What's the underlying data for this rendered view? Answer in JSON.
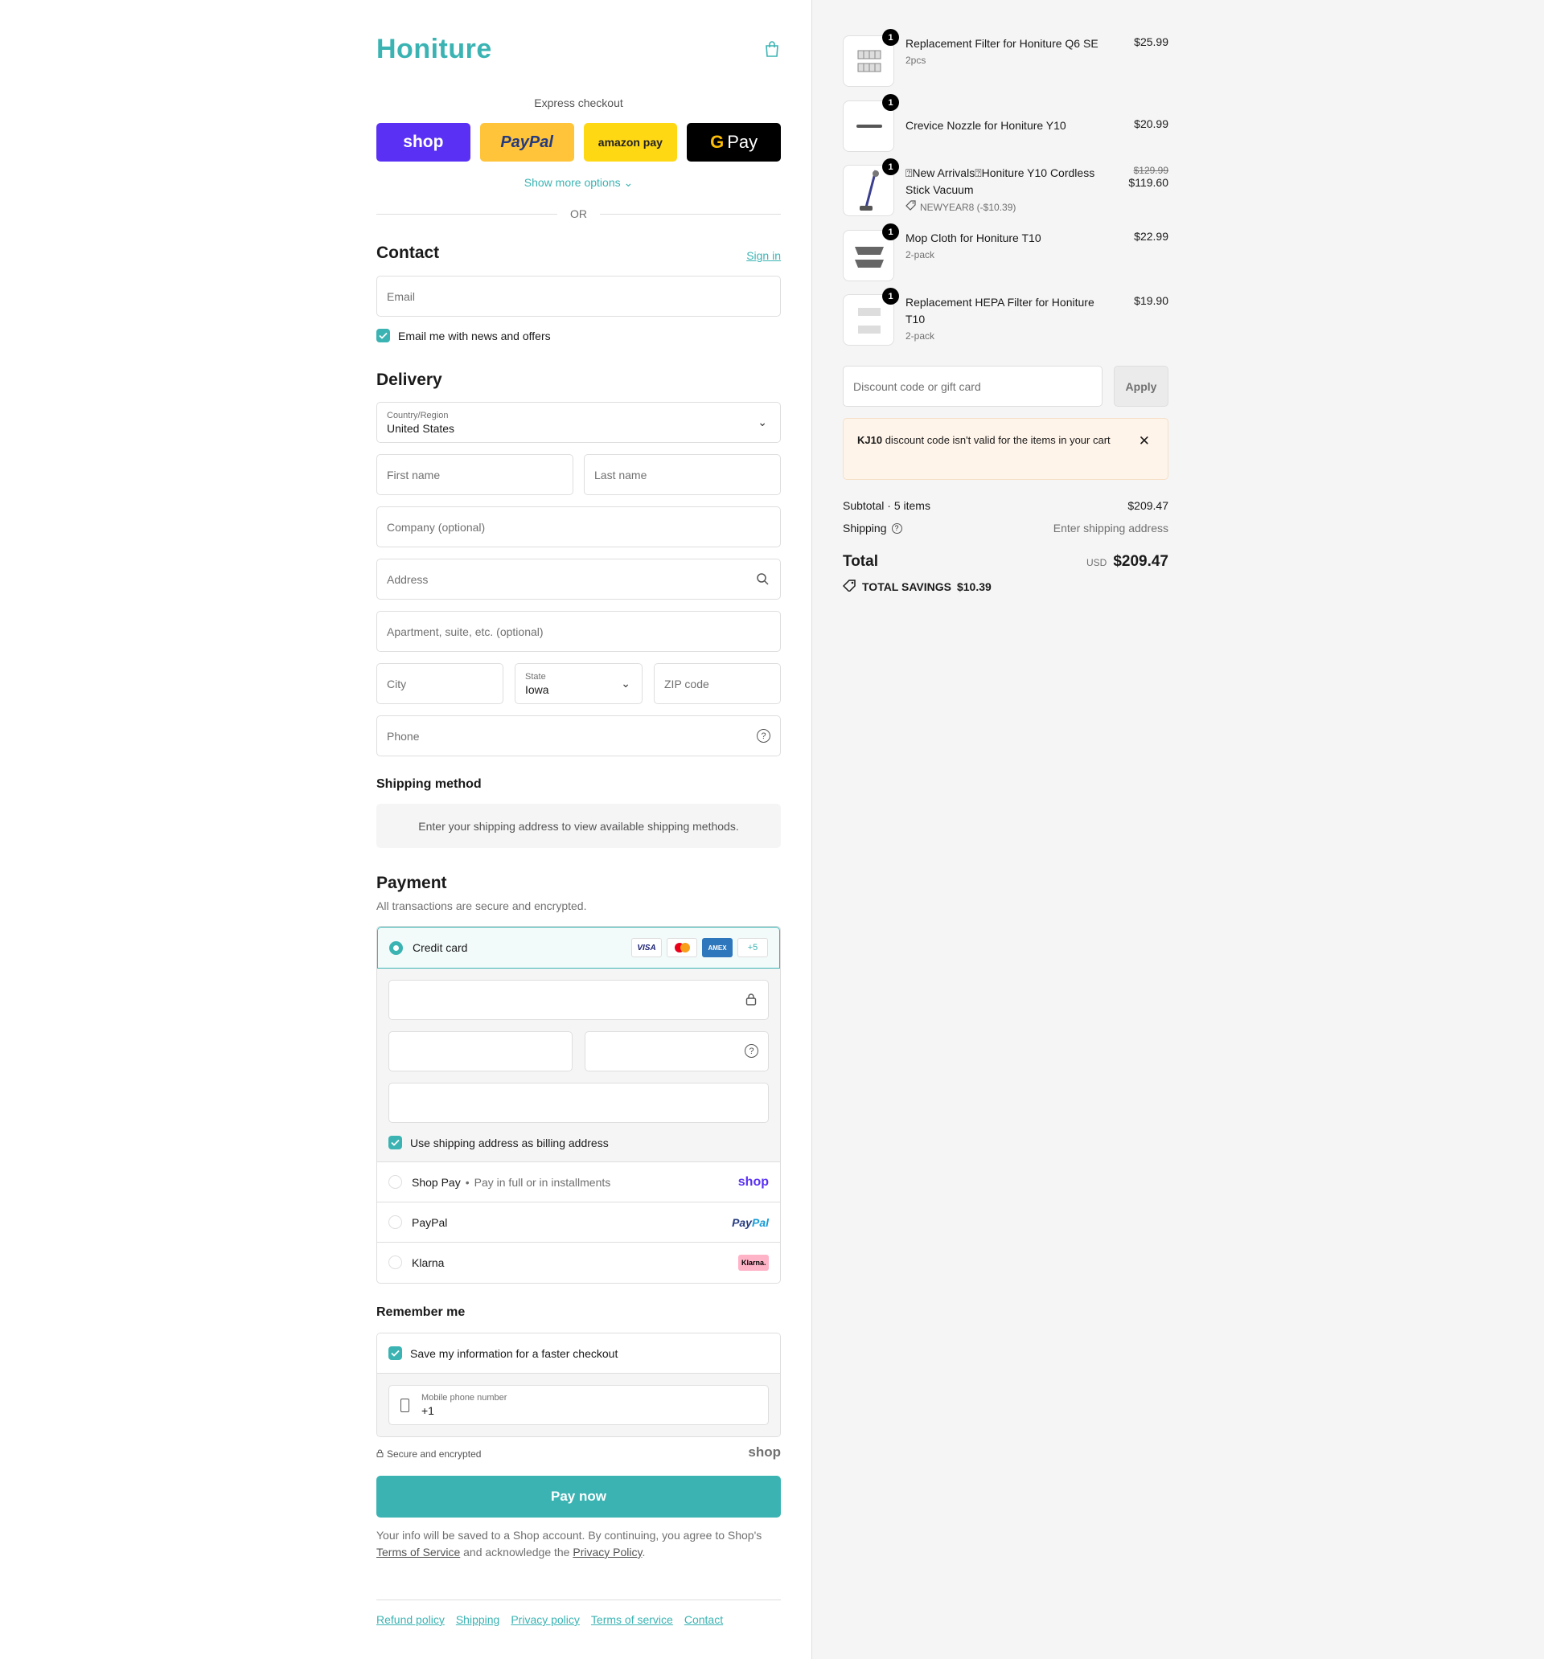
{
  "brand": {
    "logo": "Honiture",
    "accent": "#3bb3b3"
  },
  "express": {
    "label": "Express checkout",
    "shop": "shop",
    "paypal": "PayPal",
    "amazon": "amazon pay",
    "gpay": "Pay",
    "more": "Show more options",
    "or": "OR"
  },
  "contact": {
    "title": "Contact",
    "signin": "Sign in",
    "email_placeholder": "Email",
    "newsletter": "Email me with news and offers"
  },
  "delivery": {
    "title": "Delivery",
    "country_label": "Country/Region",
    "country_value": "United States",
    "first_name": "First name",
    "last_name": "Last name",
    "company": "Company (optional)",
    "address": "Address",
    "apartment": "Apartment, suite, etc. (optional)",
    "city": "City",
    "state_label": "State",
    "state_value": "Iowa",
    "zip": "ZIP code",
    "phone": "Phone"
  },
  "shipping_method": {
    "title": "Shipping method",
    "notice": "Enter your shipping address to view available shipping methods."
  },
  "payment": {
    "title": "Payment",
    "subtitle": "All transactions are secure and encrypted.",
    "credit_card": "Credit card",
    "more_cards": "+5",
    "billing_same": "Use shipping address as billing address",
    "shop_pay": "Shop Pay",
    "shop_pay_note": "Pay in full or in installments",
    "shop_logo": "shop",
    "paypal": "PayPal",
    "klarna": "Klarna",
    "klarna_logo": "Klarna."
  },
  "remember": {
    "title": "Remember me",
    "save": "Save my information for a faster checkout",
    "mobile_label": "Mobile phone number",
    "mobile_value": "+1"
  },
  "secure": {
    "text": "Secure and encrypted",
    "logo": "shop"
  },
  "pay_now": "Pay now",
  "legal": {
    "p1": "Your info will be saved to a Shop account. By continuing, you agree to Shop's",
    "tos": "Terms of Service",
    "p2": "and acknowledge the",
    "privacy": "Privacy Policy",
    "p3": "."
  },
  "footer": [
    "Refund policy",
    "Shipping",
    "Privacy policy",
    "Terms of service",
    "Contact"
  ],
  "cart": {
    "items": [
      {
        "name": "Replacement Filter for Honiture Q6 SE",
        "sub": "2pcs",
        "qty": "1",
        "price": "$25.99"
      },
      {
        "name": "Crevice Nozzle for Honiture Y10",
        "sub": "",
        "qty": "1",
        "price": "$20.99"
      },
      {
        "name": "⍰New Arrivals⍰Honiture Y10 Cordless Stick Vacuum",
        "sub": "NEWYEAR8 (-$10.39)",
        "qty": "1",
        "old_price": "$129.99",
        "price": "$119.60"
      },
      {
        "name": "Mop Cloth for Honiture T10",
        "sub": "2-pack",
        "qty": "1",
        "price": "$22.99"
      },
      {
        "name": "Replacement HEPA Filter for Honiture T10",
        "sub": "2-pack",
        "qty": "1",
        "price": "$19.90"
      }
    ],
    "discount_placeholder": "Discount code or gift card",
    "apply": "Apply",
    "error_code": "KJ10",
    "error_text": "discount code isn't valid for the items in your cart",
    "subtotal_label": "Subtotal · 5 items",
    "subtotal": "$209.47",
    "shipping_label": "Shipping",
    "shipping_value": "Enter shipping address",
    "total_label": "Total",
    "currency": "USD",
    "total": "$209.47",
    "savings_label": "TOTAL SAVINGS",
    "savings": "$10.39"
  }
}
